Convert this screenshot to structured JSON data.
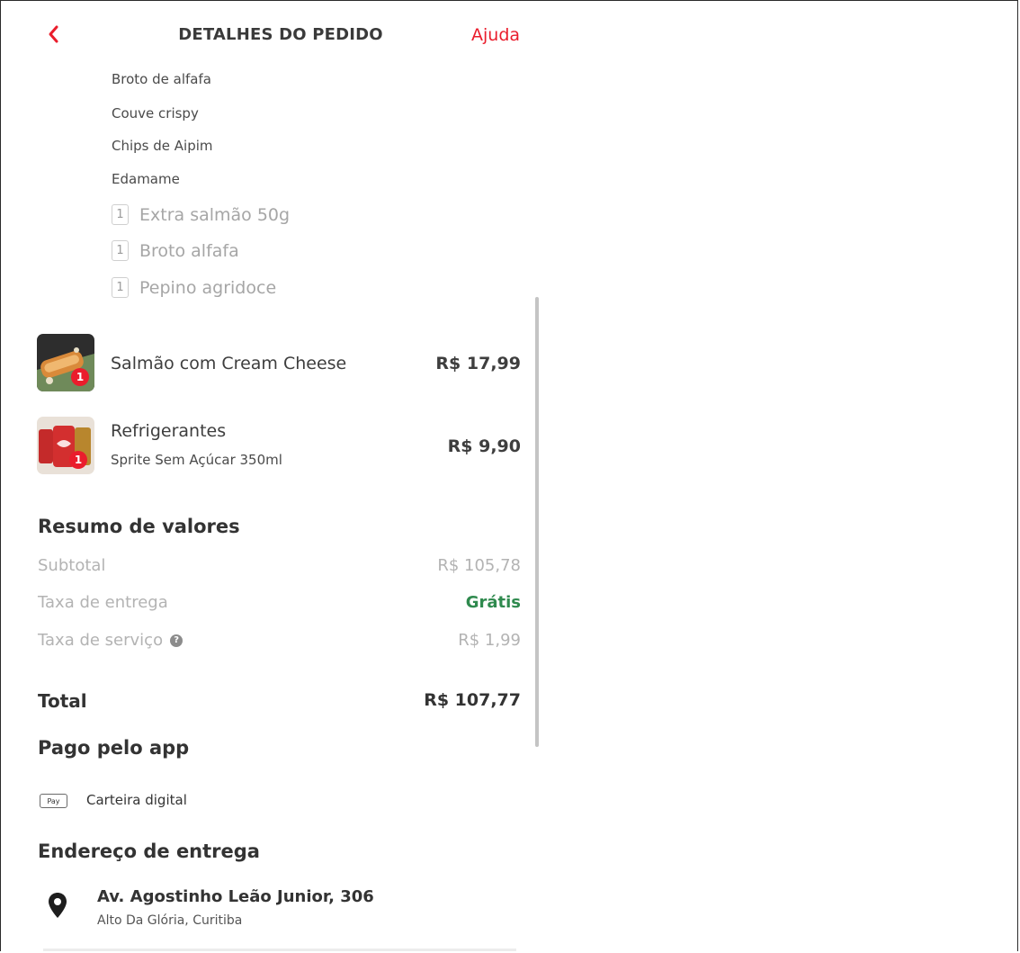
{
  "header": {
    "title": "DETALHES DO PEDIDO",
    "help_label": "Ajuda",
    "back_icon": "chevron-left-icon",
    "accent_color": "#ea1d2c"
  },
  "options": [
    "Broto de alfafa",
    "Couve crispy",
    "Chips de Aipim",
    "Edamame"
  ],
  "extras": [
    {
      "qty": "1",
      "name": "Extra salmão 50g"
    },
    {
      "qty": "1",
      "name": "Broto alfafa"
    },
    {
      "qty": "1",
      "name": "Pepino agridoce"
    }
  ],
  "items": [
    {
      "name": "Salmão com Cream Cheese",
      "detail": "",
      "price": "R$ 17,99",
      "qty_badge": "1"
    },
    {
      "name": "Refrigerantes",
      "detail": "Sprite Sem Açúcar 350ml",
      "price": "R$ 9,90",
      "qty_badge": "1"
    }
  ],
  "summary": {
    "heading": "Resumo de valores",
    "subtotal_label": "Subtotal",
    "subtotal_value": "R$ 105,78",
    "delivery_label": "Taxa de entrega",
    "delivery_value": "Grátis",
    "service_label": "Taxa de serviço",
    "service_value": "R$ 1,99",
    "total_label": "Total",
    "total_value": "R$ 107,77",
    "free_color": "#2f8a4e"
  },
  "payment": {
    "heading": "Pago pelo app",
    "method_icon_text": "Pay",
    "method_label": "Carteira digital"
  },
  "address": {
    "heading": "Endereço de entrega",
    "street": "Av. Agostinho Leão Junior, 306",
    "district": "Alto Da Glória, Curitiba",
    "icon": "location-pin-icon"
  }
}
